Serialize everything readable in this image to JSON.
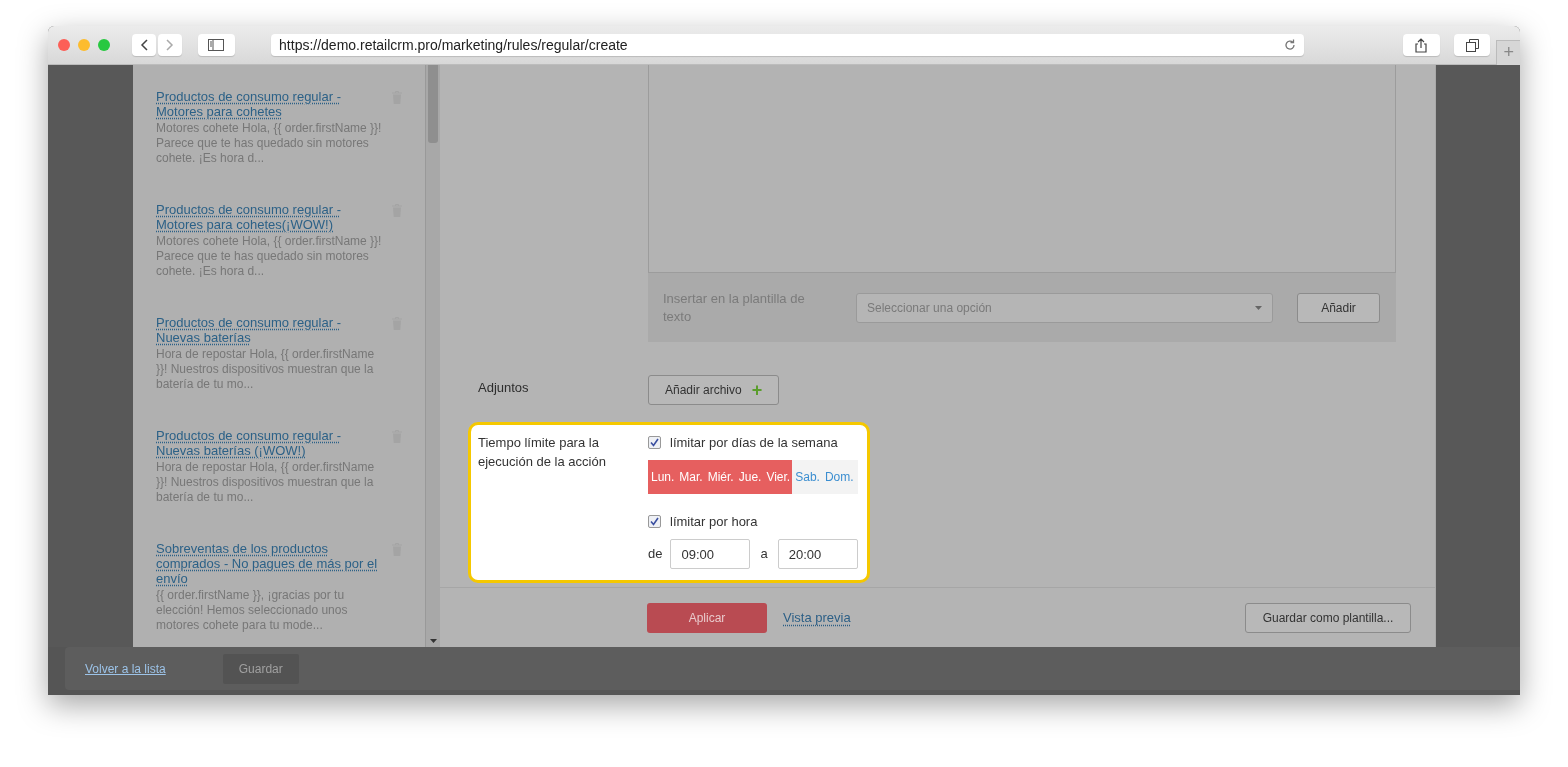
{
  "browser": {
    "url": "https://demo.retailcrm.pro/marketing/rules/regular/create",
    "new_tab": "+"
  },
  "templates": [
    {
      "title": "Productos de consumo regular - Motores para cohetes",
      "preview": "Motores cohete Hola, {{ order.firstName }}! Parece que te has quedado sin motores cohete. ¡Es hora d..."
    },
    {
      "title": "Productos de consumo regular - Motores para cohetes(¡WOW!)",
      "preview": "Motores cohete Hola, {{ order.firstName }}! Parece que te has quedado sin motores cohete. ¡Es hora d..."
    },
    {
      "title": "Productos de consumo regular - Nuevas baterías",
      "preview": "Hora de repostar Hola, {{ order.firstName }}! Nuestros dispositivos muestran que la batería de tu mo..."
    },
    {
      "title": "Productos de consumo regular - Nuevas baterías (¡WOW!)",
      "preview": "Hora de repostar Hola, {{ order.firstName }}! Nuestros dispositivos muestran que la batería de tu mo..."
    },
    {
      "title": "Sobreventas de los productos comprados - No pagues de más por el envío",
      "preview": "{{ order.firstName }}, ¡gracias por tu elección! Hemos seleccionado unos motores cohete para tu mode..."
    }
  ],
  "insert": {
    "label": "Insertar en la plantilla de texto",
    "placeholder": "Seleccionar una opción",
    "button": "Añadir"
  },
  "attachments": {
    "label": "Adjuntos",
    "button": "Añadir archivo",
    "icon": "+"
  },
  "time_limit": {
    "label": "Tiempo límite para la ejecución de la acción",
    "weekdays": {
      "label": "límitar por días de la semana",
      "checked": true
    },
    "days": [
      {
        "label": "Lun.",
        "selected": true
      },
      {
        "label": "Mar.",
        "selected": true
      },
      {
        "label": "Miér.",
        "selected": true
      },
      {
        "label": "Jue.",
        "selected": true
      },
      {
        "label": "Vier.",
        "selected": true
      },
      {
        "label": "Sab.",
        "selected": false
      },
      {
        "label": "Dom.",
        "selected": false
      }
    ],
    "hours": {
      "label": "límitar por hora",
      "checked": true
    },
    "from_label": "de",
    "from": "09:00",
    "to_label": "a",
    "to": "20:00"
  },
  "footer": {
    "apply": "Aplicar",
    "preview": "Vista previa",
    "save_template": "Guardar como plantilla..."
  },
  "bottom_bar": {
    "back": "Volver a la lista",
    "save": "Guardar",
    "save_disabled": true
  }
}
